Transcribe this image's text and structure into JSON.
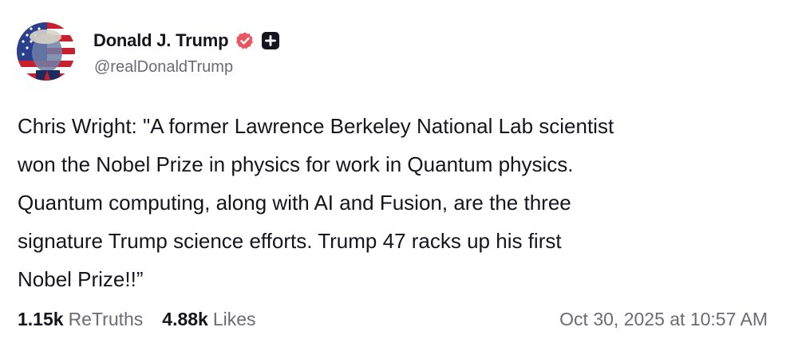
{
  "author": {
    "display_name": "Donald J. Trump",
    "handle": "@realDonaldTrump",
    "verified_icon": "verified-badge-icon",
    "plus_icon": "plus-badge-icon",
    "verified_color": "#e8565f"
  },
  "post": {
    "text": "Chris Wright: \"A former Lawrence Berkeley National Lab scientist\nwon the Nobel Prize in physics for work in Quantum physics.\nQuantum computing, along with AI and Fusion, are the three\nsignature Trump science efforts. Trump 47 racks up his first\nNobel Prize!!”"
  },
  "stats": {
    "retruths_count": "1.15k",
    "retruths_label": "ReTruths",
    "likes_count": "4.88k",
    "likes_label": "Likes"
  },
  "timestamp": "Oct 30, 2025 at 10:57 AM"
}
